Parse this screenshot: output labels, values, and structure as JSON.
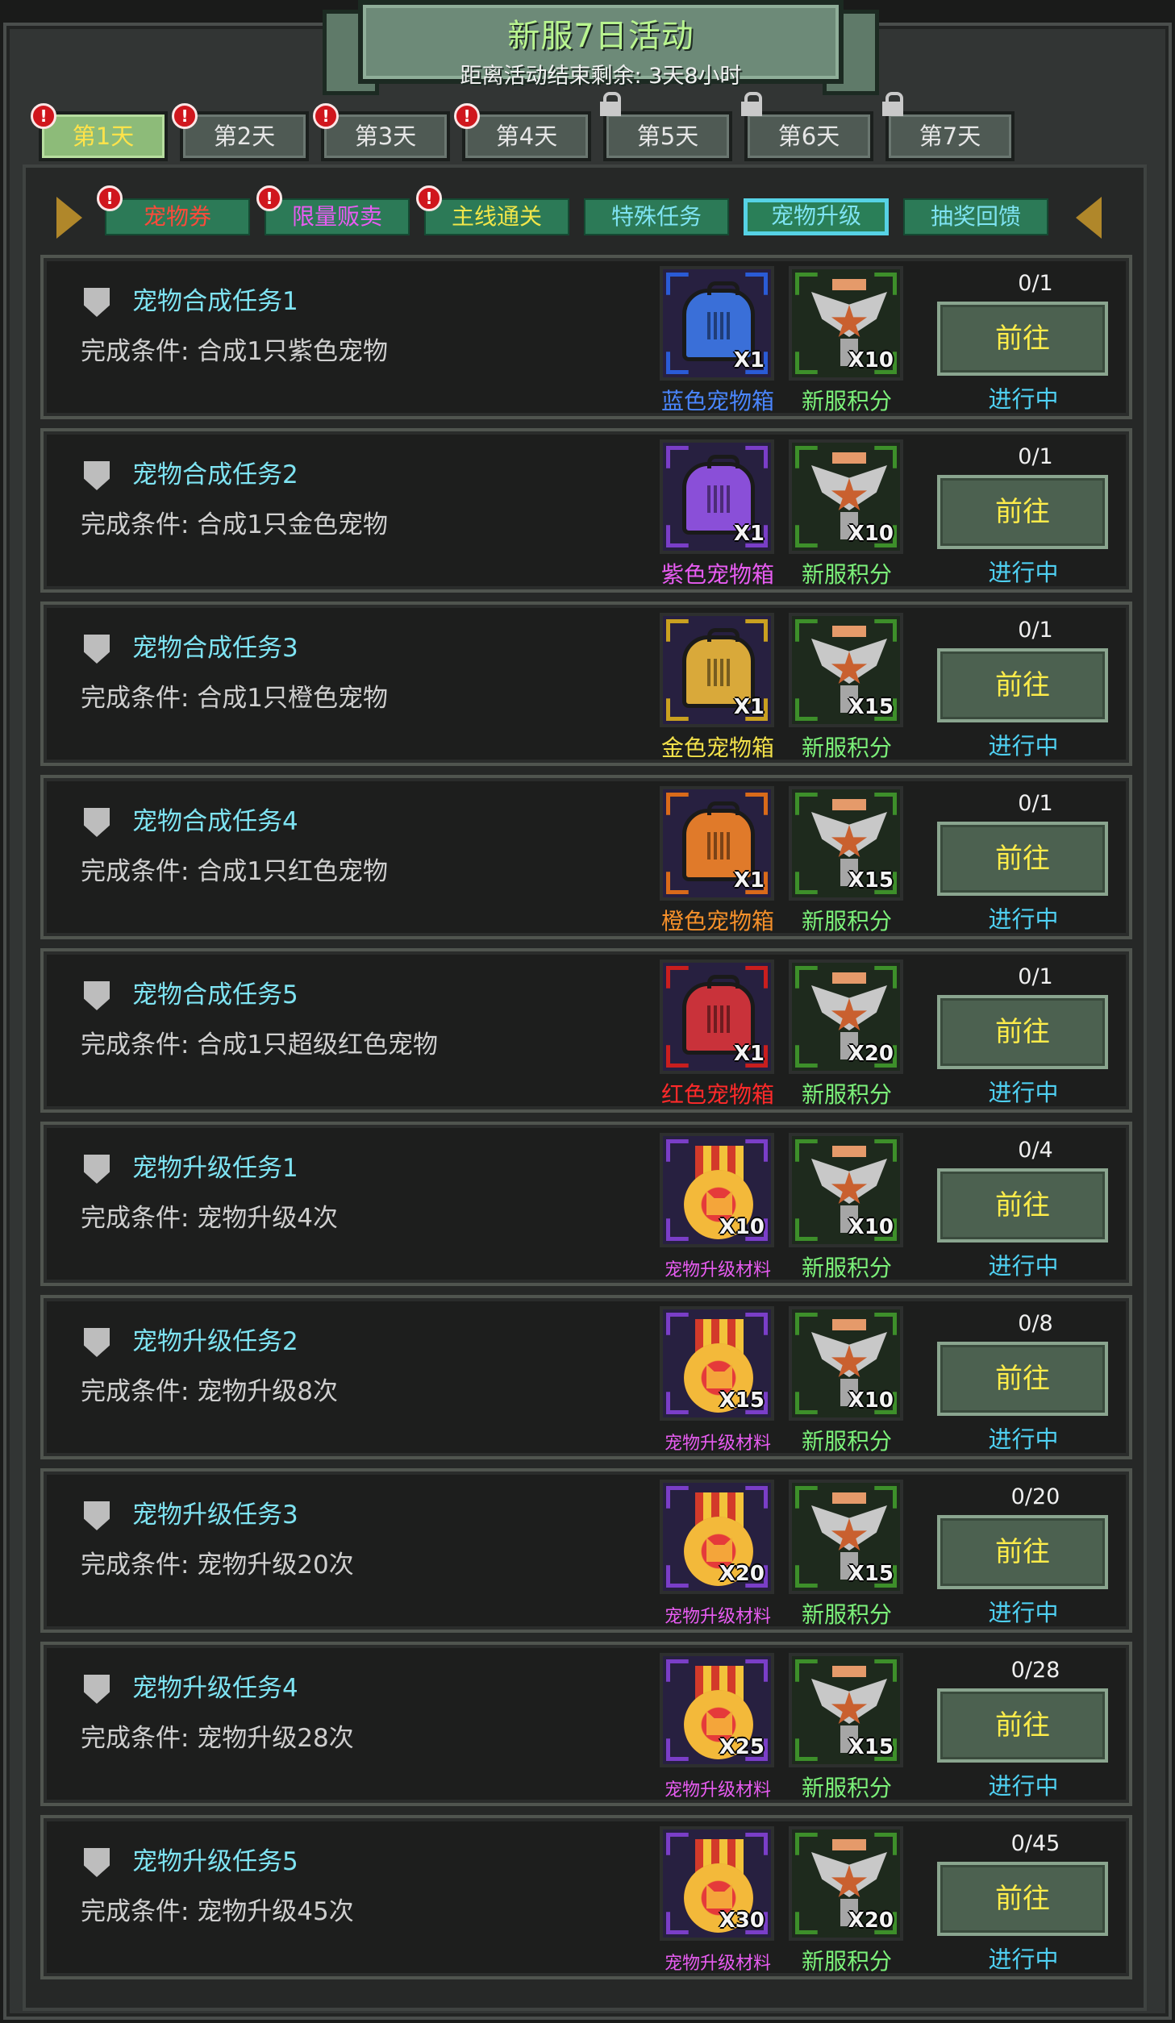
{
  "header": {
    "title": "新服7日活动",
    "subtitle": "距离活动结束剩余: 3天8小时"
  },
  "day_tabs": [
    {
      "label": "第1天",
      "active": true,
      "badge": true,
      "locked": false
    },
    {
      "label": "第2天",
      "active": false,
      "badge": true,
      "locked": false
    },
    {
      "label": "第3天",
      "active": false,
      "badge": true,
      "locked": false
    },
    {
      "label": "第4天",
      "active": false,
      "badge": true,
      "locked": false
    },
    {
      "label": "第5天",
      "active": false,
      "badge": false,
      "locked": true
    },
    {
      "label": "第6天",
      "active": false,
      "badge": false,
      "locked": true
    },
    {
      "label": "第7天",
      "active": false,
      "badge": false,
      "locked": true
    }
  ],
  "sub_tabs": [
    {
      "label": "宠物券",
      "color": "#ff4a3a",
      "badge": true,
      "selected": false
    },
    {
      "label": "限量贩卖",
      "color": "#e85cf2",
      "badge": true,
      "selected": false
    },
    {
      "label": "主线通关",
      "color": "#f1e64a",
      "badge": true,
      "selected": false
    },
    {
      "label": "特殊任务",
      "color": "#7ee3f2",
      "badge": false,
      "selected": false
    },
    {
      "label": "宠物升级",
      "color": "#7ee3f2",
      "badge": false,
      "selected": true
    },
    {
      "label": "抽奖回馈",
      "color": "#7ee3f2",
      "badge": false,
      "selected": false
    }
  ],
  "badge_symbol": "!",
  "tasks": [
    {
      "title": "宠物合成任务1",
      "condition": "完成条件: 合成1只紫色宠物",
      "reward1": {
        "type": "crate",
        "name": "蓝色宠物箱",
        "qty": "X1",
        "color": "#3a6fd8",
        "name_color": "#4a86ff",
        "frame": "#2a5bd6"
      },
      "reward2": {
        "name": "新服积分",
        "qty": "X10",
        "name_color": "#7cf27a"
      },
      "progress": "0/1",
      "button": "前往",
      "status": "进行中"
    },
    {
      "title": "宠物合成任务2",
      "condition": "完成条件: 合成1只金色宠物",
      "reward1": {
        "type": "crate",
        "name": "紫色宠物箱",
        "qty": "X1",
        "color": "#8a4fd8",
        "name_color": "#e85cf2",
        "frame": "#7a3ec8"
      },
      "reward2": {
        "name": "新服积分",
        "qty": "X10",
        "name_color": "#7cf27a"
      },
      "progress": "0/1",
      "button": "前往",
      "status": "进行中"
    },
    {
      "title": "宠物合成任务3",
      "condition": "完成条件: 合成1只橙色宠物",
      "reward1": {
        "type": "crate",
        "name": "金色宠物箱",
        "qty": "X1",
        "color": "#d9a93a",
        "name_color": "#f2e04a",
        "frame": "#c9a020"
      },
      "reward2": {
        "name": "新服积分",
        "qty": "X15",
        "name_color": "#7cf27a"
      },
      "progress": "0/1",
      "button": "前往",
      "status": "进行中"
    },
    {
      "title": "宠物合成任务4",
      "condition": "完成条件: 合成1只红色宠物",
      "reward1": {
        "type": "crate",
        "name": "橙色宠物箱",
        "qty": "X1",
        "color": "#e07a2a",
        "name_color": "#f5902a",
        "frame": "#d96a1a"
      },
      "reward2": {
        "name": "新服积分",
        "qty": "X15",
        "name_color": "#7cf27a"
      },
      "progress": "0/1",
      "button": "前往",
      "status": "进行中"
    },
    {
      "title": "宠物合成任务5",
      "condition": "完成条件: 合成1只超级红色宠物",
      "reward1": {
        "type": "crate",
        "name": "红色宠物箱",
        "qty": "X1",
        "color": "#c9323a",
        "name_color": "#ff2a2a",
        "frame": "#c91e1e"
      },
      "reward2": {
        "name": "新服积分",
        "qty": "X20",
        "name_color": "#7cf27a"
      },
      "progress": "0/1",
      "button": "前往",
      "status": "进行中"
    },
    {
      "title": "宠物升级任务1",
      "condition": "完成条件: 宠物升级4次",
      "reward1": {
        "type": "medal",
        "name": "宠物升级材料",
        "qty": "X10",
        "name_color": "#e85cf2",
        "frame": "#7a3ec8"
      },
      "reward2": {
        "name": "新服积分",
        "qty": "X10",
        "name_color": "#7cf27a"
      },
      "progress": "0/4",
      "button": "前往",
      "status": "进行中"
    },
    {
      "title": "宠物升级任务2",
      "condition": "完成条件: 宠物升级8次",
      "reward1": {
        "type": "medal",
        "name": "宠物升级材料",
        "qty": "X15",
        "name_color": "#e85cf2",
        "frame": "#7a3ec8"
      },
      "reward2": {
        "name": "新服积分",
        "qty": "X10",
        "name_color": "#7cf27a"
      },
      "progress": "0/8",
      "button": "前往",
      "status": "进行中"
    },
    {
      "title": "宠物升级任务3",
      "condition": "完成条件: 宠物升级20次",
      "reward1": {
        "type": "medal",
        "name": "宠物升级材料",
        "qty": "X20",
        "name_color": "#e85cf2",
        "frame": "#7a3ec8"
      },
      "reward2": {
        "name": "新服积分",
        "qty": "X15",
        "name_color": "#7cf27a"
      },
      "progress": "0/20",
      "button": "前往",
      "status": "进行中"
    },
    {
      "title": "宠物升级任务4",
      "condition": "完成条件: 宠物升级28次",
      "reward1": {
        "type": "medal",
        "name": "宠物升级材料",
        "qty": "X25",
        "name_color": "#e85cf2",
        "frame": "#7a3ec8"
      },
      "reward2": {
        "name": "新服积分",
        "qty": "X15",
        "name_color": "#7cf27a"
      },
      "progress": "0/28",
      "button": "前往",
      "status": "进行中"
    },
    {
      "title": "宠物升级任务5",
      "condition": "完成条件: 宠物升级45次",
      "reward1": {
        "type": "medal",
        "name": "宠物升级材料",
        "qty": "X30",
        "name_color": "#e85cf2",
        "frame": "#7a3ec8"
      },
      "reward2": {
        "name": "新服积分",
        "qty": "X20",
        "name_color": "#7cf27a"
      },
      "progress": "0/45",
      "button": "前往",
      "status": "进行中"
    }
  ]
}
